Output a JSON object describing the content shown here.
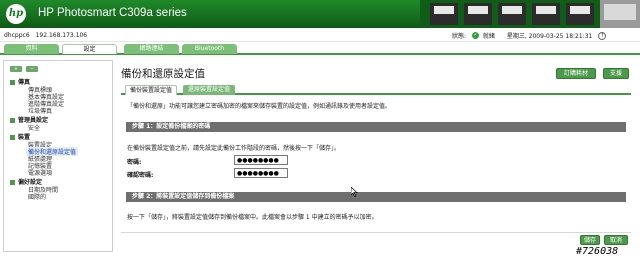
{
  "header": {
    "logo_text": "hp",
    "product_title": "HP Photosmart C309a series"
  },
  "status_bar": {
    "host_name": "dhcppc6",
    "host_ip": "192.168.173.106",
    "status_label": "狀態:",
    "status_value": "就緒",
    "datetime": "星期三, 2009-03-25 18:21:31"
  },
  "tabs": [
    {
      "label": "資料"
    },
    {
      "label": "設定"
    },
    {
      "label": "網路連結"
    },
    {
      "label": "Bluetooth"
    }
  ],
  "sidebar": {
    "groups": [
      {
        "label": "傳真",
        "items": [
          "傳真標頭",
          "基本傳真設定",
          "進階傳真設定",
          "垃圾傳真"
        ]
      },
      {
        "label": "管理員設定",
        "items": [
          "安全"
        ]
      },
      {
        "label": "裝置",
        "items": [
          "裝置設定",
          "備份和還原設定值",
          "紙張處理",
          "記憶裝置",
          "電源選項"
        ]
      },
      {
        "label": "偏好設定",
        "items": [
          "日期及時間",
          "國際的"
        ]
      }
    ]
  },
  "main": {
    "page_title": "備份和還原設定值",
    "order_supplies_button": "訂購耗材",
    "support_button": "支援",
    "subtabs": [
      "備份裝置設定值",
      "還原裝置設定值"
    ],
    "description": "「備份和還原」功能可讓您建立密碼加密的檔案來儲存裝置的設定值，例如通訊錄及使用者設定值。",
    "step1_header": "步驟 1：設定備份檔案的密碼",
    "step1_note": "在備份裝置設定值之前，請先設定此備份工作階段的密碼，然後按一下「儲存」。",
    "password_label": "密碼:",
    "password_value": "●●●●●●●●",
    "confirm_label": "確認密碼:",
    "confirm_value": "●●●●●●●●",
    "step2_header": "步驟 2：將裝置設定值儲存到備份檔案",
    "step2_note": "按一下「儲存」，將裝置設定值儲存到備份檔案中。此檔案會以步驟 1 中建立的密碼予以加密。",
    "save_button": "儲存",
    "cancel_button": "取消"
  },
  "watermark": "#726038",
  "colors": {
    "header_green": "#1a7a25",
    "tab_green": "#7bbf79",
    "accent_green": "#3f9b3d",
    "section_gray": "#6f6f6f"
  }
}
